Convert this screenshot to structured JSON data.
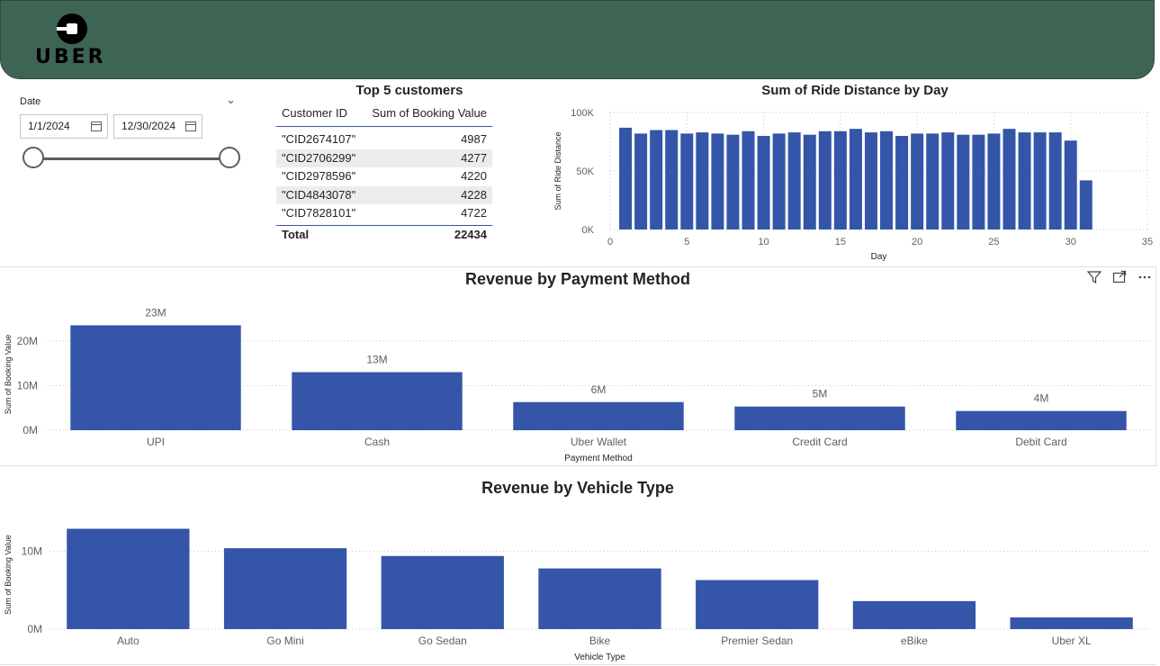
{
  "header": {
    "logo_text": "UBER"
  },
  "date_slicer": {
    "title": "Date",
    "start": "1/1/2024",
    "end": "12/30/2024"
  },
  "top_customers": {
    "title": "Top 5 customers",
    "columns": [
      "Customer ID",
      "Sum of Booking Value"
    ],
    "rows": [
      [
        "\"CID2674107\"",
        "4987"
      ],
      [
        "\"CID2706299\"",
        "4277"
      ],
      [
        "\"CID2978596\"",
        "4220"
      ],
      [
        "\"CID4843078\"",
        "4228"
      ],
      [
        "\"CID7828101\"",
        "4722"
      ]
    ],
    "total_label": "Total",
    "total_value": "22434"
  },
  "chart_data": [
    {
      "type": "bar",
      "title": "Sum of Ride Distance by Day",
      "xlabel": "Day",
      "ylabel": "Sum of Ride Distance",
      "x": [
        1,
        2,
        3,
        4,
        5,
        6,
        7,
        8,
        9,
        10,
        11,
        12,
        13,
        14,
        15,
        16,
        17,
        18,
        19,
        20,
        21,
        22,
        23,
        24,
        25,
        26,
        27,
        28,
        29,
        30,
        31
      ],
      "values": [
        87000,
        82000,
        85000,
        85000,
        82000,
        83000,
        82000,
        81000,
        84000,
        80000,
        82000,
        83000,
        81000,
        84000,
        84000,
        86000,
        83000,
        84000,
        80000,
        82000,
        82000,
        83000,
        81000,
        81000,
        82000,
        86000,
        83000,
        83000,
        83000,
        76000,
        42000
      ],
      "xlim": [
        0,
        35
      ],
      "ylim": [
        0,
        100000
      ],
      "x_ticks": [
        "0",
        "5",
        "10",
        "15",
        "20",
        "25",
        "30",
        "35"
      ],
      "y_ticks": [
        "0K",
        "50K",
        "100K"
      ],
      "color": "#3455a8"
    },
    {
      "type": "bar",
      "title": "Revenue by Payment Method",
      "xlabel": "Payment Method",
      "ylabel": "Sum of Booking Value",
      "categories": [
        "UPI",
        "Cash",
        "Uber Wallet",
        "Credit Card",
        "Debit Card"
      ],
      "values": [
        23.5,
        13,
        6.3,
        5.3,
        4.3
      ],
      "data_labels": [
        "23M",
        "13M",
        "6M",
        "5M",
        "4M"
      ],
      "ylim": [
        0,
        25
      ],
      "y_ticks": [
        "0M",
        "10M",
        "20M"
      ],
      "color": "#3455a8"
    },
    {
      "type": "bar",
      "title": "Revenue by Vehicle Type",
      "xlabel": "Vehicle Type",
      "ylabel": "Sum of Booking Value",
      "categories": [
        "Auto",
        "Go Mini",
        "Go Sedan",
        "Bike",
        "Premier Sedan",
        "eBike",
        "Uber XL"
      ],
      "values": [
        12.9,
        10.4,
        9.4,
        7.8,
        6.3,
        3.6,
        1.5
      ],
      "ylim": [
        0,
        14
      ],
      "y_ticks": [
        "0M",
        "10M"
      ],
      "color": "#3455a8"
    }
  ]
}
